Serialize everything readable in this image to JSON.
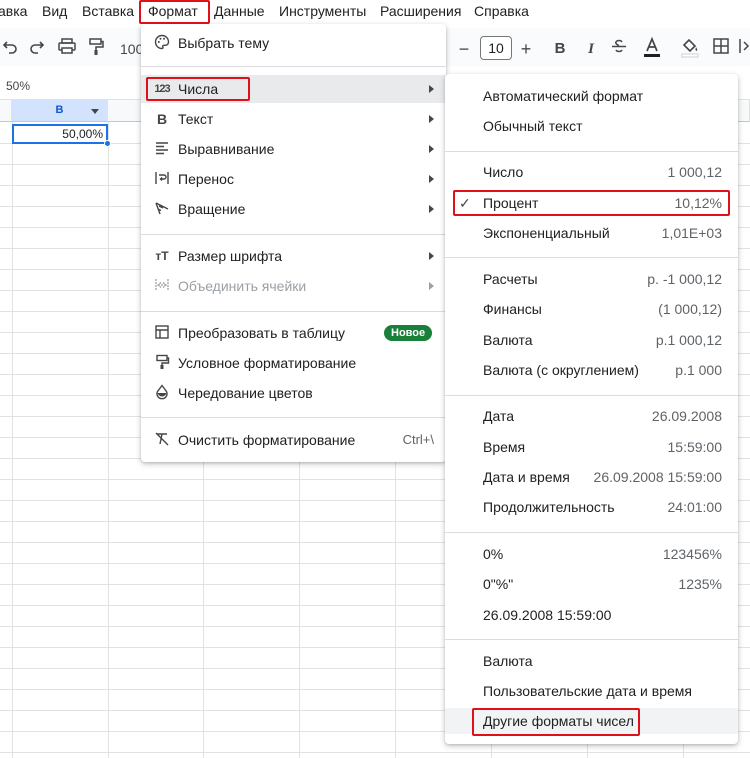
{
  "menubar": {
    "items": [
      "авка",
      "Вид",
      "Вставка",
      "Формат",
      "Данные",
      "Инструменты",
      "Расширения",
      "Справка"
    ]
  },
  "toolbar": {
    "zoom": "100",
    "font_size": "10",
    "bold": "B",
    "italic": "I"
  },
  "namebox": {
    "value": "50%"
  },
  "sheet": {
    "selected_column": "B",
    "selected_cell_value": "50,00%"
  },
  "format_menu": {
    "items": [
      {
        "label": "Выбрать тему",
        "icon": "palette-icon"
      },
      {
        "label": "Числа",
        "icon": "123-icon",
        "submenu": true
      },
      {
        "label": "Текст",
        "icon": "bold-icon",
        "submenu": true
      },
      {
        "label": "Выравнивание",
        "icon": "align-icon",
        "submenu": true
      },
      {
        "label": "Перенос",
        "icon": "wrap-icon",
        "submenu": true
      },
      {
        "label": "Вращение",
        "icon": "rotate-icon",
        "submenu": true
      },
      {
        "label": "Размер шрифта",
        "icon": "font-size-icon",
        "submenu": true
      },
      {
        "label": "Объединить ячейки",
        "icon": "merge-icon",
        "submenu": true,
        "disabled": true
      },
      {
        "label": "Преобразовать в таблицу",
        "icon": "table-icon",
        "badge": "Новое"
      },
      {
        "label": "Условное форматирование",
        "icon": "paint-roller-icon"
      },
      {
        "label": "Чередование цветов",
        "icon": "color-drop-icon"
      },
      {
        "label": "Очистить форматирование",
        "icon": "clear-format-icon",
        "shortcut": "Ctrl+\\"
      }
    ]
  },
  "numbers_menu": {
    "items": [
      {
        "label": "Автоматический формат",
        "value": ""
      },
      {
        "label": "Обычный текст",
        "value": ""
      },
      {
        "label": "Число",
        "value": "1 000,12"
      },
      {
        "label": "Процент",
        "value": "10,12%",
        "checked": true
      },
      {
        "label": "Экспоненциальный",
        "value": "1,01E+03"
      },
      {
        "label": "Расчеты",
        "value": "р. -1 000,12"
      },
      {
        "label": "Финансы",
        "value": "(1 000,12)"
      },
      {
        "label": "Валюта",
        "value": "р.1 000,12"
      },
      {
        "label": "Валюта (с округлением)",
        "value": "р.1 000"
      },
      {
        "label": "Дата",
        "value": "26.09.2008"
      },
      {
        "label": "Время",
        "value": "15:59:00"
      },
      {
        "label": "Дата и время",
        "value": "26.09.2008 15:59:00"
      },
      {
        "label": "Продолжительность",
        "value": "24:01:00"
      },
      {
        "label": "0%",
        "value": "123456%"
      },
      {
        "label": "0\"%\"",
        "value": "1235%"
      },
      {
        "label": "26.09.2008 15:59:00",
        "value": ""
      },
      {
        "label": "Валюта",
        "value": ""
      },
      {
        "label": "Пользовательские дата и время",
        "value": ""
      },
      {
        "label": "Другие форматы чисел",
        "value": ""
      }
    ]
  },
  "colors": {
    "highlight_box": "#e0101a",
    "selection_blue": "#1a73e8",
    "badge_green": "#188038"
  }
}
